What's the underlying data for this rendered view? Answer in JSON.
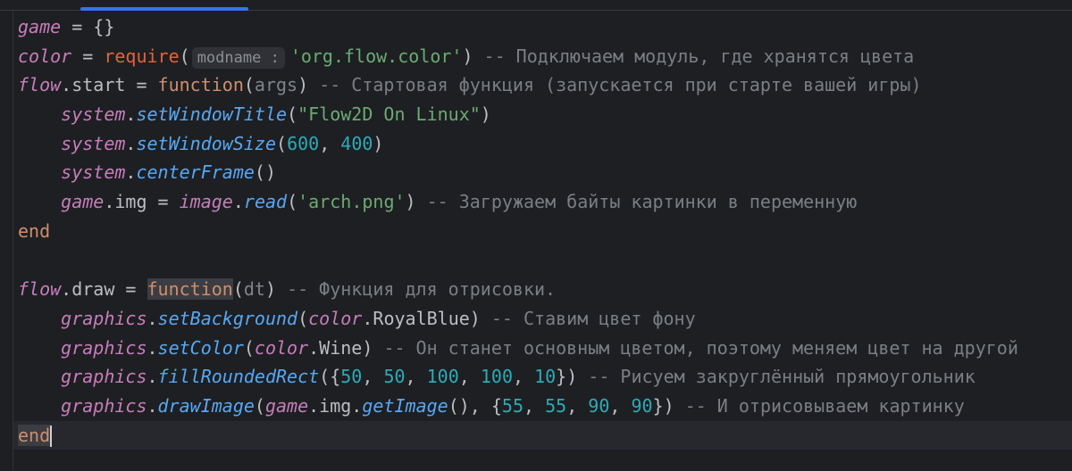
{
  "editor": {
    "accent": "#3574f0",
    "current_line": 14,
    "lines": [
      [
        [
          "game",
          "v"
        ],
        [
          " = {}",
          "p"
        ]
      ],
      [
        [
          "color",
          "v"
        ],
        [
          " = ",
          "p"
        ],
        [
          "require",
          "r"
        ],
        [
          "(",
          "p"
        ],
        [
          "modname :",
          "h"
        ],
        [
          "'org.flow.color'",
          "s"
        ],
        [
          ") ",
          "p"
        ],
        [
          "-- Подключаем модуль, где хранятся цвета",
          "c"
        ]
      ],
      [
        [
          "flow",
          "v"
        ],
        [
          ".start = ",
          "p"
        ],
        [
          "function",
          "k"
        ],
        [
          "(",
          "p"
        ],
        [
          "args",
          "a"
        ],
        [
          ") ",
          "p"
        ],
        [
          "-- Стартовая функция (запускается при старте вашей игры)",
          "c"
        ]
      ],
      [
        [
          "    ",
          "p"
        ],
        [
          "system",
          "v"
        ],
        [
          ".",
          "p"
        ],
        [
          "setWindowTitle",
          "m"
        ],
        [
          "(",
          "p"
        ],
        [
          "\"Flow2D On Linux\"",
          "s"
        ],
        [
          ")",
          "p"
        ]
      ],
      [
        [
          "    ",
          "p"
        ],
        [
          "system",
          "v"
        ],
        [
          ".",
          "p"
        ],
        [
          "setWindowSize",
          "m"
        ],
        [
          "(",
          "p"
        ],
        [
          "600",
          "n"
        ],
        [
          ", ",
          "p"
        ],
        [
          "400",
          "n"
        ],
        [
          ")",
          "p"
        ]
      ],
      [
        [
          "    ",
          "p"
        ],
        [
          "system",
          "v"
        ],
        [
          ".",
          "p"
        ],
        [
          "centerFrame",
          "m"
        ],
        [
          "()",
          "p"
        ]
      ],
      [
        [
          "    ",
          "p"
        ],
        [
          "game",
          "v"
        ],
        [
          ".img = ",
          "p"
        ],
        [
          "image",
          "v"
        ],
        [
          ".",
          "p"
        ],
        [
          "read",
          "m"
        ],
        [
          "(",
          "p"
        ],
        [
          "'arch.png'",
          "s"
        ],
        [
          ") ",
          "p"
        ],
        [
          "-- Загружаем байты картинки в переменную",
          "c"
        ]
      ],
      [
        [
          "end",
          "k"
        ]
      ],
      [],
      [
        [
          "flow",
          "v"
        ],
        [
          ".draw = ",
          "p"
        ],
        [
          "function",
          "k hl"
        ],
        [
          "(",
          "p"
        ],
        [
          "dt",
          "a"
        ],
        [
          ") ",
          "p"
        ],
        [
          "-- Функция для отрисовки.",
          "c"
        ]
      ],
      [
        [
          "    ",
          "p"
        ],
        [
          "graphics",
          "v"
        ],
        [
          ".",
          "p"
        ],
        [
          "setBackground",
          "m"
        ],
        [
          "(",
          "p"
        ],
        [
          "color",
          "v"
        ],
        [
          ".RoyalBlue) ",
          "p"
        ],
        [
          "-- Ставим цвет фону",
          "c"
        ]
      ],
      [
        [
          "    ",
          "p"
        ],
        [
          "graphics",
          "v"
        ],
        [
          ".",
          "p"
        ],
        [
          "setColor",
          "m"
        ],
        [
          "(",
          "p"
        ],
        [
          "color",
          "v"
        ],
        [
          ".Wine) ",
          "p"
        ],
        [
          "-- Он станет основным цветом, поэтому меняем цвет на другой",
          "c"
        ]
      ],
      [
        [
          "    ",
          "p"
        ],
        [
          "graphics",
          "v"
        ],
        [
          ".",
          "p"
        ],
        [
          "fillRoundedRect",
          "m"
        ],
        [
          "({",
          "p"
        ],
        [
          "50",
          "n"
        ],
        [
          ", ",
          "p"
        ],
        [
          "50",
          "n"
        ],
        [
          ", ",
          "p"
        ],
        [
          "100",
          "n"
        ],
        [
          ", ",
          "p"
        ],
        [
          "100",
          "n"
        ],
        [
          ", ",
          "p"
        ],
        [
          "10",
          "n"
        ],
        [
          "}) ",
          "p"
        ],
        [
          "-- Рисуем закруглённый прямоугольник",
          "c"
        ]
      ],
      [
        [
          "    ",
          "p"
        ],
        [
          "graphics",
          "v"
        ],
        [
          ".",
          "p"
        ],
        [
          "drawImage",
          "m"
        ],
        [
          "(",
          "p"
        ],
        [
          "game",
          "v"
        ],
        [
          ".img.",
          "p"
        ],
        [
          "getImage",
          "m"
        ],
        [
          "(), {",
          "p"
        ],
        [
          "55",
          "n"
        ],
        [
          ", ",
          "p"
        ],
        [
          "55",
          "n"
        ],
        [
          ", ",
          "p"
        ],
        [
          "90",
          "n"
        ],
        [
          ", ",
          "p"
        ],
        [
          "90",
          "n"
        ],
        [
          "}) ",
          "p"
        ],
        [
          "-- И отрисовываем картинку",
          "c"
        ]
      ],
      [
        [
          "end",
          "k hl"
        ]
      ]
    ]
  }
}
